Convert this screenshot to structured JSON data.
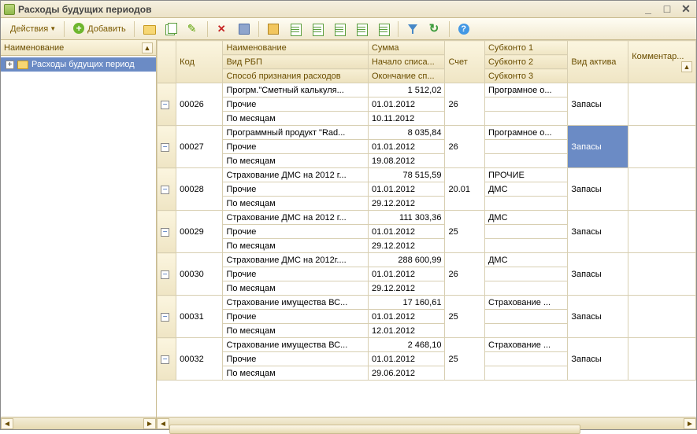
{
  "window": {
    "title": "Расходы будущих периодов"
  },
  "toolbar": {
    "actions": "Действия",
    "add": "Добавить"
  },
  "tree": {
    "header": "Наименование",
    "root": "Расходы будущих период"
  },
  "grid": {
    "headers": {
      "code": "Код",
      "name": "Наименование",
      "sum": "Сумма",
      "account": "Счет",
      "sub1": "Субконто 1",
      "asset": "Вид актива",
      "comment": "Комментар...",
      "rbp": "Вид РБП",
      "writeoff_start": "Начало списа...",
      "sub2": "Субконто 2",
      "rec_method": "Способ признания расходов",
      "writeoff_end": "Окончание сп...",
      "sub3": "Субконто 3"
    },
    "rows": [
      {
        "code": "00026",
        "name": "Прогрм.\"Сметный калькуля...",
        "sum": "1 512,02",
        "account": "26",
        "sub1": "Програмное о...",
        "asset": "Запасы",
        "rbp": "Прочие",
        "start": "01.01.2012",
        "sub2": "",
        "method": "По месяцам",
        "end": "10.11.2012",
        "sub3": ""
      },
      {
        "code": "00027",
        "name": "Программный продукт \"Rad...",
        "sum": "8 035,84",
        "account": "26",
        "sub1": "Програмное о...",
        "asset": "Запасы",
        "asset_selected": true,
        "rbp": "Прочие",
        "start": "01.01.2012",
        "sub2": "",
        "method": "По месяцам",
        "end": "19.08.2012",
        "sub3": ""
      },
      {
        "code": "00028",
        "name": "Страхование ДМС на 2012 г...",
        "sum": "78 515,59",
        "account": "20.01",
        "sub1": "ПРОЧИЕ",
        "asset": "Запасы",
        "rbp": "Прочие",
        "start": "01.01.2012",
        "sub2": "ДМС",
        "method": "По месяцам",
        "end": "29.12.2012",
        "sub3": ""
      },
      {
        "code": "00029",
        "name": "Страхование ДМС на 2012 г...",
        "sum": "111 303,36",
        "account": "25",
        "sub1": "ДМС",
        "asset": "Запасы",
        "rbp": "Прочие",
        "start": "01.01.2012",
        "sub2": "",
        "method": "По месяцам",
        "end": "29.12.2012",
        "sub3": ""
      },
      {
        "code": "00030",
        "name": "Страхование ДМС на 2012г....",
        "sum": "288 600,99",
        "account": "26",
        "sub1": "ДМС",
        "asset": "Запасы",
        "rbp": "Прочие",
        "start": "01.01.2012",
        "sub2": "",
        "method": "По месяцам",
        "end": "29.12.2012",
        "sub3": ""
      },
      {
        "code": "00031",
        "name": "Страхование имущества ВС...",
        "sum": "17 160,61",
        "account": "25",
        "sub1": "Страхование ...",
        "asset": "Запасы",
        "rbp": "Прочие",
        "start": "01.01.2012",
        "sub2": "",
        "method": "По месяцам",
        "end": "12.01.2012",
        "sub3": ""
      },
      {
        "code": "00032",
        "name": "Страхование имущества ВС...",
        "sum": "2 468,10",
        "account": "25",
        "sub1": "Страхование ...",
        "asset": "Запасы",
        "rbp": "Прочие",
        "start": "01.01.2012",
        "sub2": "",
        "method": "По месяцам",
        "end": "29.06.2012",
        "sub3": ""
      }
    ]
  }
}
